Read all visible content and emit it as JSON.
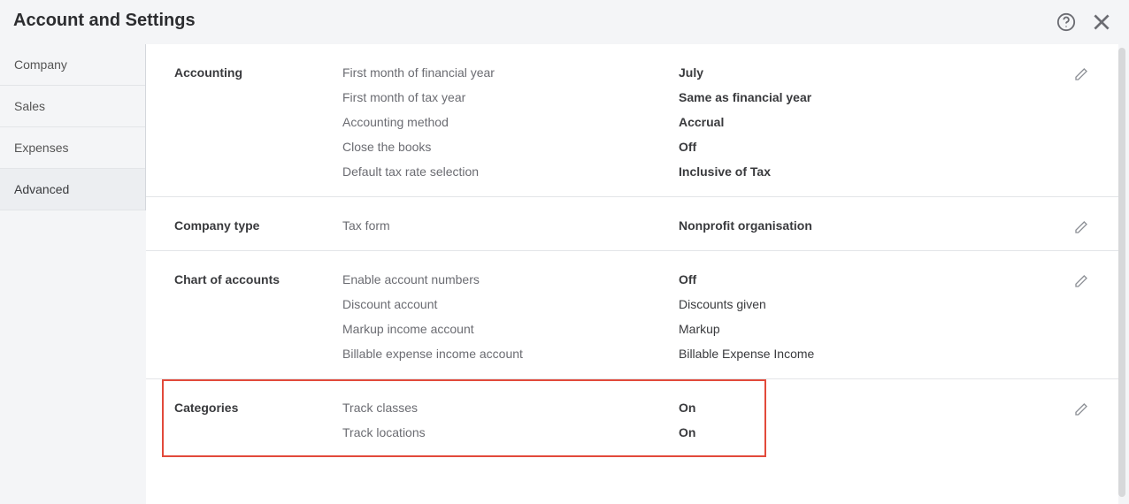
{
  "header": {
    "title": "Account and Settings"
  },
  "sidebar": {
    "items": [
      {
        "label": "Company"
      },
      {
        "label": "Sales"
      },
      {
        "label": "Expenses"
      },
      {
        "label": "Advanced"
      }
    ],
    "activeIndex": 3
  },
  "sections": {
    "accounting": {
      "title": "Accounting",
      "rows": [
        {
          "label": "First month of financial year",
          "value": "July",
          "strong": true
        },
        {
          "label": "First month of tax year",
          "value": "Same as financial year",
          "strong": true
        },
        {
          "label": "Accounting method",
          "value": "Accrual",
          "strong": true
        },
        {
          "label": "Close the books",
          "value": "Off",
          "strong": true
        },
        {
          "label": "Default tax rate selection",
          "value": "Inclusive of Tax",
          "strong": true
        }
      ]
    },
    "company_type": {
      "title": "Company type",
      "rows": [
        {
          "label": "Tax form",
          "value": "Nonprofit organisation",
          "strong": true
        }
      ]
    },
    "chart_of_accounts": {
      "title": "Chart of accounts",
      "rows": [
        {
          "label": "Enable account numbers",
          "value": "Off",
          "strong": true
        },
        {
          "label": "Discount account",
          "value": "Discounts given",
          "strong": false
        },
        {
          "label": "Markup income account",
          "value": "Markup",
          "strong": false
        },
        {
          "label": "Billable expense income account",
          "value": "Billable Expense Income",
          "strong": false
        }
      ]
    },
    "categories": {
      "title": "Categories",
      "rows": [
        {
          "label": "Track classes",
          "value": "On",
          "strong": true
        },
        {
          "label": "Track locations",
          "value": "On",
          "strong": true
        }
      ]
    }
  }
}
